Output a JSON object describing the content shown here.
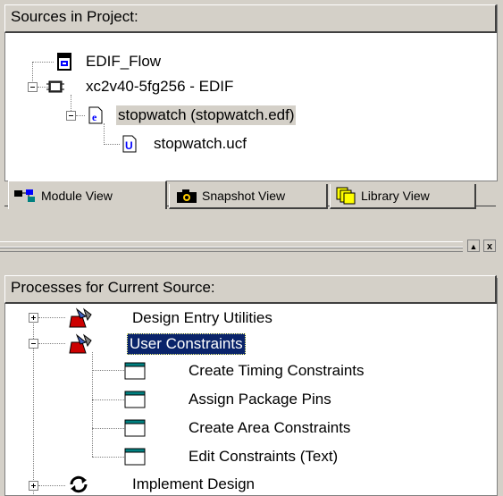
{
  "sources": {
    "header": "Sources in Project:",
    "items": [
      {
        "label": "EDIF_Flow",
        "icon": "project-icon"
      },
      {
        "label": "xc2v40-5fg256 - EDIF",
        "icon": "chip-icon"
      },
      {
        "label": "stopwatch (stopwatch.edf)",
        "icon": "edif-file-icon"
      },
      {
        "label": "stopwatch.ucf",
        "icon": "ucf-file-icon"
      }
    ]
  },
  "tabs": [
    {
      "label": "Module View",
      "icon": "module-view-icon"
    },
    {
      "label": "Snapshot View",
      "icon": "camera-icon"
    },
    {
      "label": "Library View",
      "icon": "library-icon"
    }
  ],
  "window_buttons": {
    "restore": "▲",
    "close": "x"
  },
  "processes": {
    "header": "Processes for Current Source:",
    "items": [
      {
        "label": "Design Entry Utilities",
        "icon": "toolbox-icon"
      },
      {
        "label": "User Constraints",
        "icon": "toolbox-icon"
      },
      {
        "label": "Create Timing Constraints",
        "icon": "window-icon"
      },
      {
        "label": "Assign Package Pins",
        "icon": "window-icon"
      },
      {
        "label": "Create Area Constraints",
        "icon": "window-icon"
      },
      {
        "label": "Edit Constraints (Text)",
        "icon": "window-icon"
      },
      {
        "label": "Implement Design",
        "icon": "refresh-icon"
      }
    ]
  },
  "colors": {
    "selection": "#0a246a",
    "window_bg": "#d4d0c8",
    "accent_teal": "#008080"
  }
}
